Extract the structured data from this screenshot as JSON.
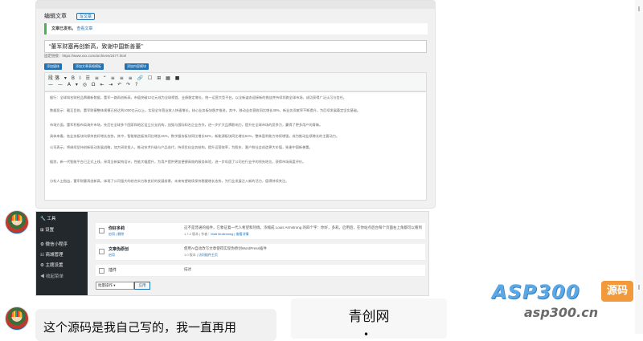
{
  "editor": {
    "heading": "编辑文章",
    "add_new": "写文章",
    "notice_prefix": "文章已发布。",
    "notice_link": "查看文章",
    "post_title": "“董军财塞再创新高，致谢中国新善董”",
    "permalink": "固定链接：https://www.xxx.com/archives/2477.html",
    "buttons": [
      "添加媒体",
      "添加文章表格模板",
      "添加内容模块"
    ],
    "toolbar_row1": "段落 ▾ B I ☰ ≡ “ ≡ ≡ ≡ 🔗 ☐ ⊞ ▦ ■",
    "toolbar_row2": "— — A ▾ ◎ Ω ⇤ ⇥ ↶ ↷ ?",
    "paragraphs": [
      "据行：全球知名财经品牌最新数据，董军一路再创新高，市值突破12亿元成为全球榜首，业绩稳定增长，统一运营大型平台，以全新姿态迎接新的挑战并持续领跑全球市场，成功获得广泛认可与信任。",
      "数据显示：截至目前，董军财塞整体规模已经达到1000亿元以上，实现全年营业收入快速增长，核心业务板块稳步推进。其中，移动业务营收同比增长38%，新业务贡献率不断提升，为后续发展奠定坚实基础。",
      "市场方面，董军积极布局海外市场，先后在全球多个国家和地区设立分支机构，加强与国际知名企业合作，进一步扩大品牌影响力，提升在全球市场的竞争力，赢得了更多用户的青睐。",
      "具体来看，各业务板块均保持良好增长态势。其中，智能制造板块同比增长45%，数字服务板块同比增长52%，新能源板块同比增长61%，整体盈利能力持续增强，成为推动业绩增长的主要动力。",
      "公司表示，将继续坚持创新驱动发展战略，加大研发投入，推动技术升级与产品迭代，持续优化业务结构，提升运营效率，为股东、客户和社会创造更大价值，致谢中国新善董。",
      "据悉，新一代智能平台已正式上线，采用全新架构设计，性能大幅提升，为用户提供更加便捷高效的服务体验，进一步巩固了公司在行业中的领先地位，获得市场高度评价。",
      "分析人士指出，董军财塞再创新高，体现了公司强大的综合实力和良好的发展前景，未来有望继续保持稳健增长态势，为行业发展注入新的活力，值得持续关注。"
    ]
  },
  "wp_admin": {
    "menu": [
      "工具",
      "设置",
      "微信小程序",
      "商城管理",
      "主题设置",
      "收起菜单"
    ],
    "plugins": [
      {
        "name": "你好多莉",
        "actions": "启用 | 删除",
        "desc": "这不是普通的插件，它象征着一代人希望和热情，浓缩成 Louis Armstrong 的四个字：你好，多莉。启用后，在你站点后台每个页面右上角都可以看到一句来自 Hello, Dolly 的歌词。",
        "meta_version": "1.7.2 版本 | 作者：",
        "meta_links": "Matt Mullenweg | 查看详情"
      },
      {
        "name": "文章伪原创",
        "actions": "启用",
        "desc": "使用AI自动改写文章使得实现伪原创WordPress插件",
        "meta_version": "1.0 版本 | ",
        "meta_links": "访问插件主页"
      },
      {
        "name": "插件",
        "actions": "",
        "desc": "描述",
        "meta_version": "",
        "meta_links": ""
      }
    ],
    "bulk_action": "批量操作 ▾",
    "apply": "应用"
  },
  "chat": {
    "message": "这个源码是我自己写的，我一直再用",
    "card_title": "青创网",
    "card_sub": "•"
  },
  "watermark": {
    "brand": "ASP300",
    "badge": "源码",
    "url": "asp300.cn",
    "brand_color": "#5aa9e6",
    "badge_color": "#f29a3b"
  }
}
